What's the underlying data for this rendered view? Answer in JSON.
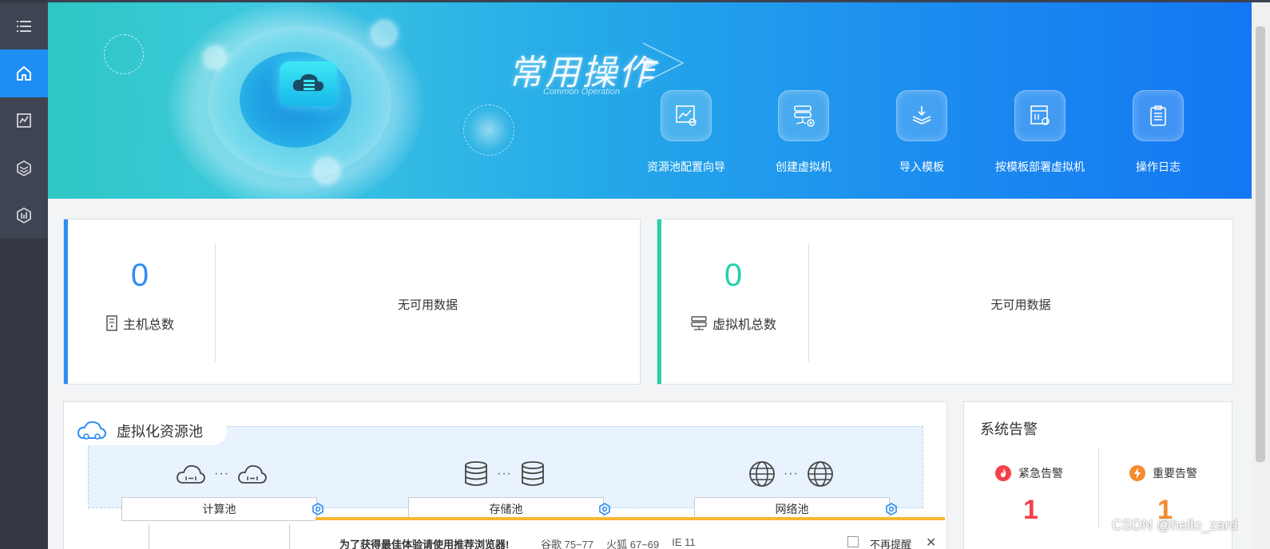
{
  "sidebar": {
    "items": [
      {
        "name": "menu",
        "icon": "menu-list-icon"
      },
      {
        "name": "home",
        "icon": "home-icon",
        "active": true
      },
      {
        "name": "monitor",
        "icon": "monitor-chart-icon"
      },
      {
        "name": "resource",
        "icon": "hexagon-layers-icon"
      },
      {
        "name": "report",
        "icon": "report-icon"
      }
    ]
  },
  "banner": {
    "title": "常用操作",
    "subtitle": "Common Operation",
    "operations": [
      {
        "label": "资源池配置向导",
        "icon": "pool-wizard-icon"
      },
      {
        "label": "创建虚拟机",
        "icon": "create-vm-icon"
      },
      {
        "label": "导入模板",
        "icon": "import-template-icon"
      },
      {
        "label": "按模板部署虚拟机",
        "icon": "deploy-template-icon"
      },
      {
        "label": "操作日志",
        "icon": "operation-log-icon"
      }
    ]
  },
  "cards": {
    "hosts": {
      "count": "0",
      "label": "主机总数",
      "empty": "无可用数据",
      "color": "#2e8ef2"
    },
    "vms": {
      "count": "0",
      "label": "虚拟机总数",
      "empty": "无可用数据",
      "color": "#26d0a8"
    }
  },
  "pool": {
    "title": "虚拟化资源池",
    "compute": {
      "label": "计算池",
      "dots": "···"
    },
    "storage": {
      "label": "存储池",
      "dots": "···"
    },
    "network": {
      "label": "网络池",
      "dots": "···"
    }
  },
  "alarm": {
    "title": "系统告警",
    "urgent": {
      "label": "紧急告警",
      "count": "1",
      "color": "#f5404a"
    },
    "important": {
      "label": "重要告警",
      "count": "1",
      "color": "#f58b2e"
    }
  },
  "browser_warning": {
    "text": "为了获得最佳体验请使用推荐浏览器!",
    "chrome": "谷歌 75~77",
    "firefox": "火狐 67~69",
    "ie": "IE 11",
    "no_remind": "不再提醒",
    "close": "✕"
  },
  "watermark": "CSDN @hello_zard"
}
